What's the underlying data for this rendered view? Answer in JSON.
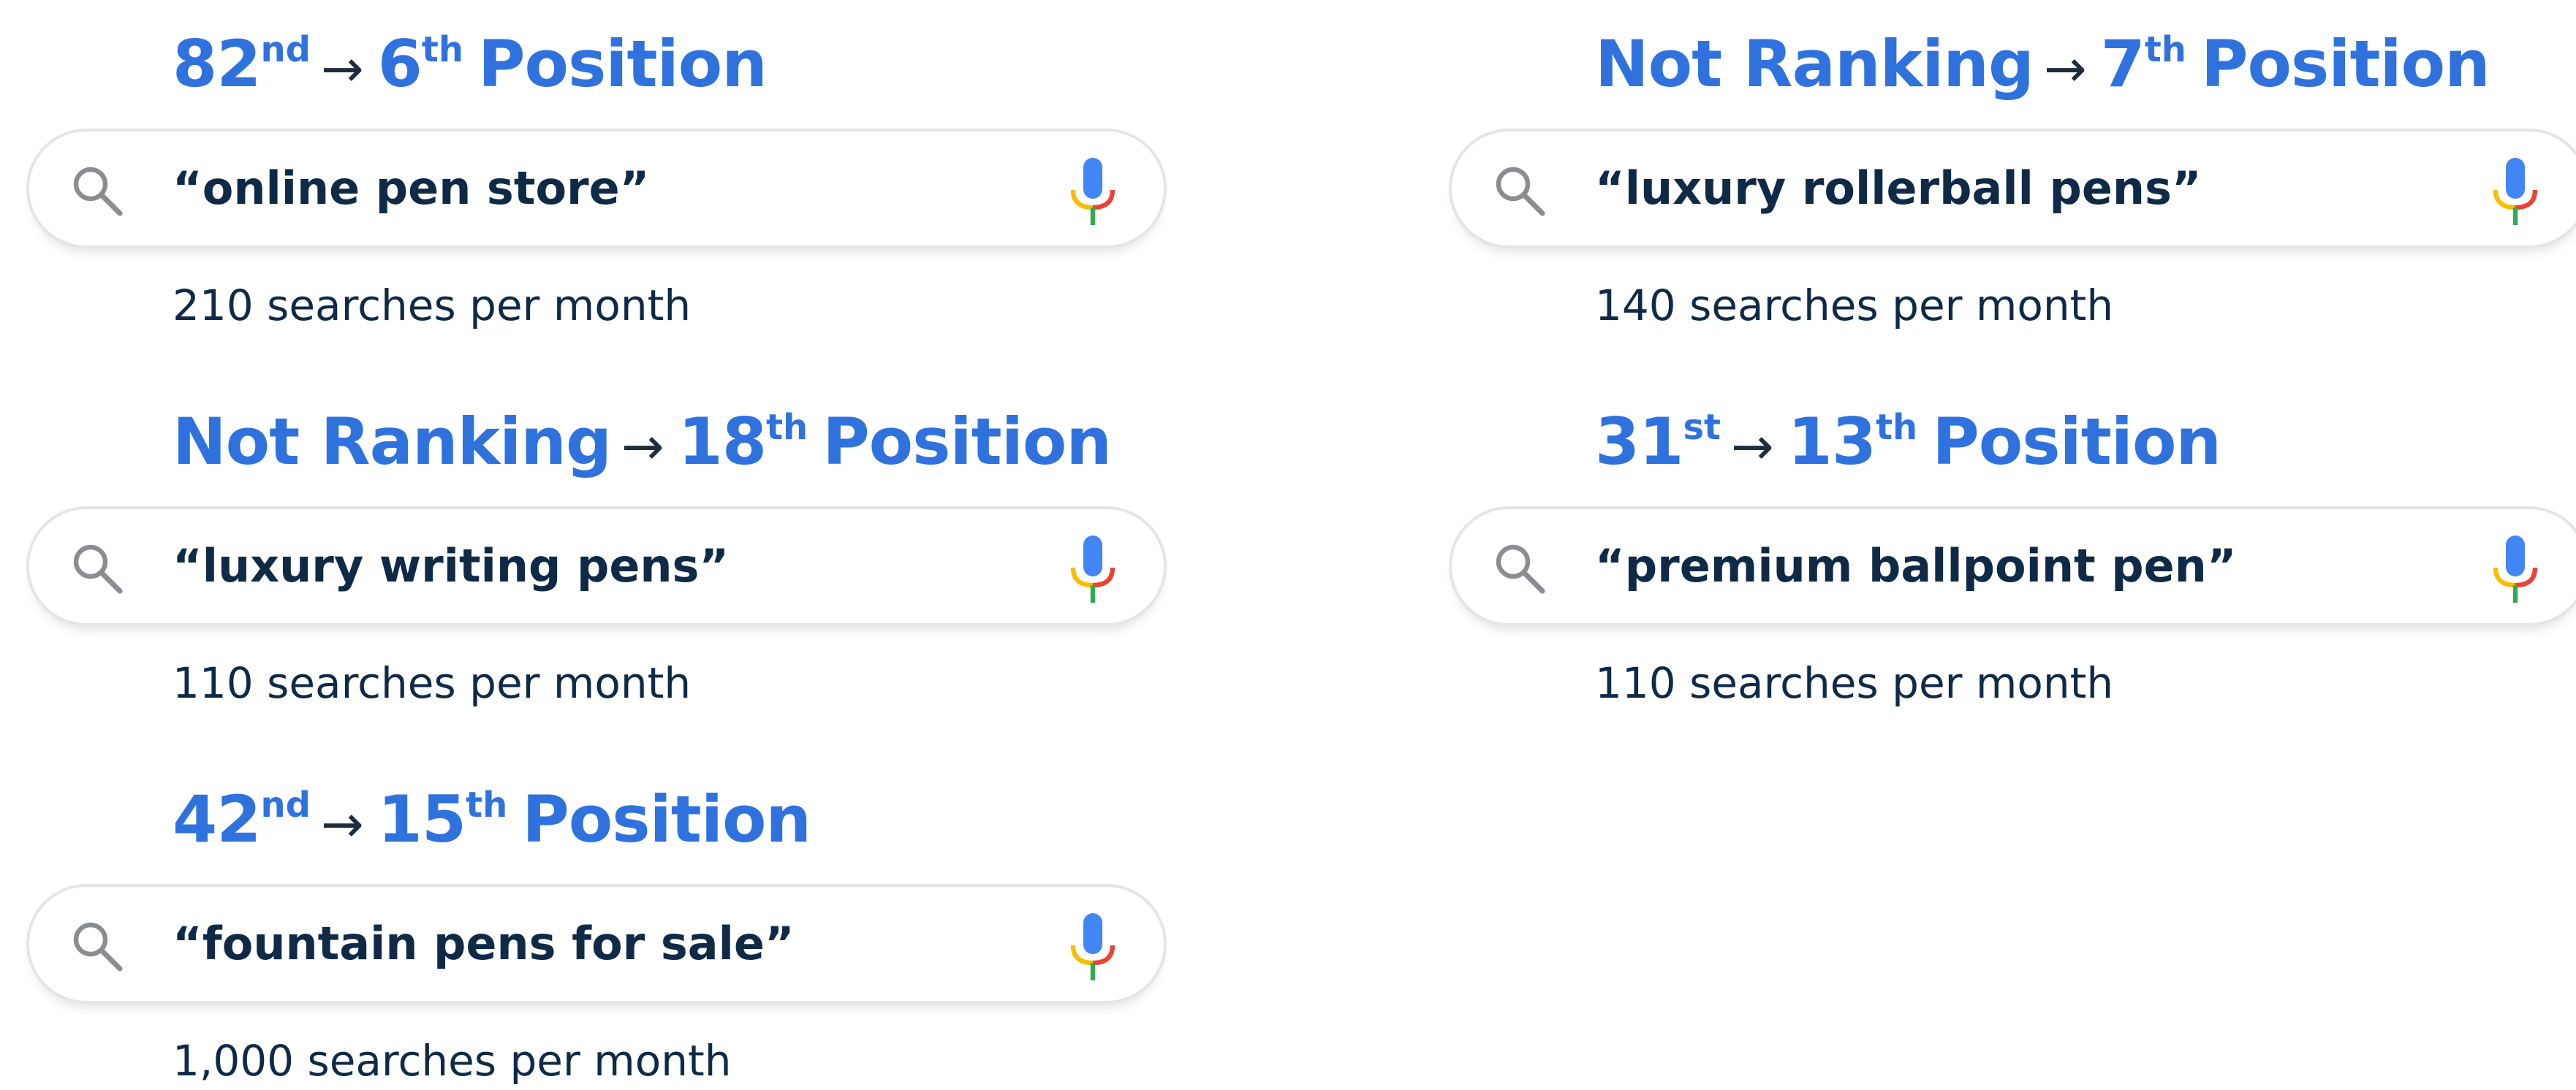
{
  "arrow": "→",
  "cards": [
    {
      "from_main": "82",
      "from_sup": "nd",
      "to_main": "6",
      "to_sup": "th",
      "suffix": "Position",
      "query": "“online pen store”",
      "searches": "210 searches per month"
    },
    {
      "from_main": "Not Ranking",
      "from_sup": "",
      "to_main": "7",
      "to_sup": "th",
      "suffix": "Position",
      "query": "“luxury rollerball pens”",
      "searches": "140 searches per month"
    },
    {
      "from_main": "Not Ranking",
      "from_sup": "",
      "to_main": "18",
      "to_sup": "th",
      "suffix": "Position",
      "query": "“luxury writing pens”",
      "searches": "110 searches per month"
    },
    {
      "from_main": "31",
      "from_sup": "st",
      "to_main": "13",
      "to_sup": "th",
      "suffix": "Position",
      "query": "“premium ballpoint pen”",
      "searches": "110 searches per month"
    },
    {
      "from_main": "42",
      "from_sup": "nd",
      "to_main": "15",
      "to_sup": "th",
      "suffix": "Position",
      "query": "“fountain pens for sale”",
      "searches": "1,000 searches per month"
    }
  ],
  "icons": {
    "search": "search-icon",
    "mic": "microphone-icon"
  },
  "colors": {
    "heading": "#2f72de",
    "text": "#0f2a47",
    "border": "#e3e5e8",
    "mic_blue": "#4285f4",
    "mic_red": "#ea4335",
    "mic_yellow": "#fbbc05",
    "mic_green": "#34a853"
  }
}
